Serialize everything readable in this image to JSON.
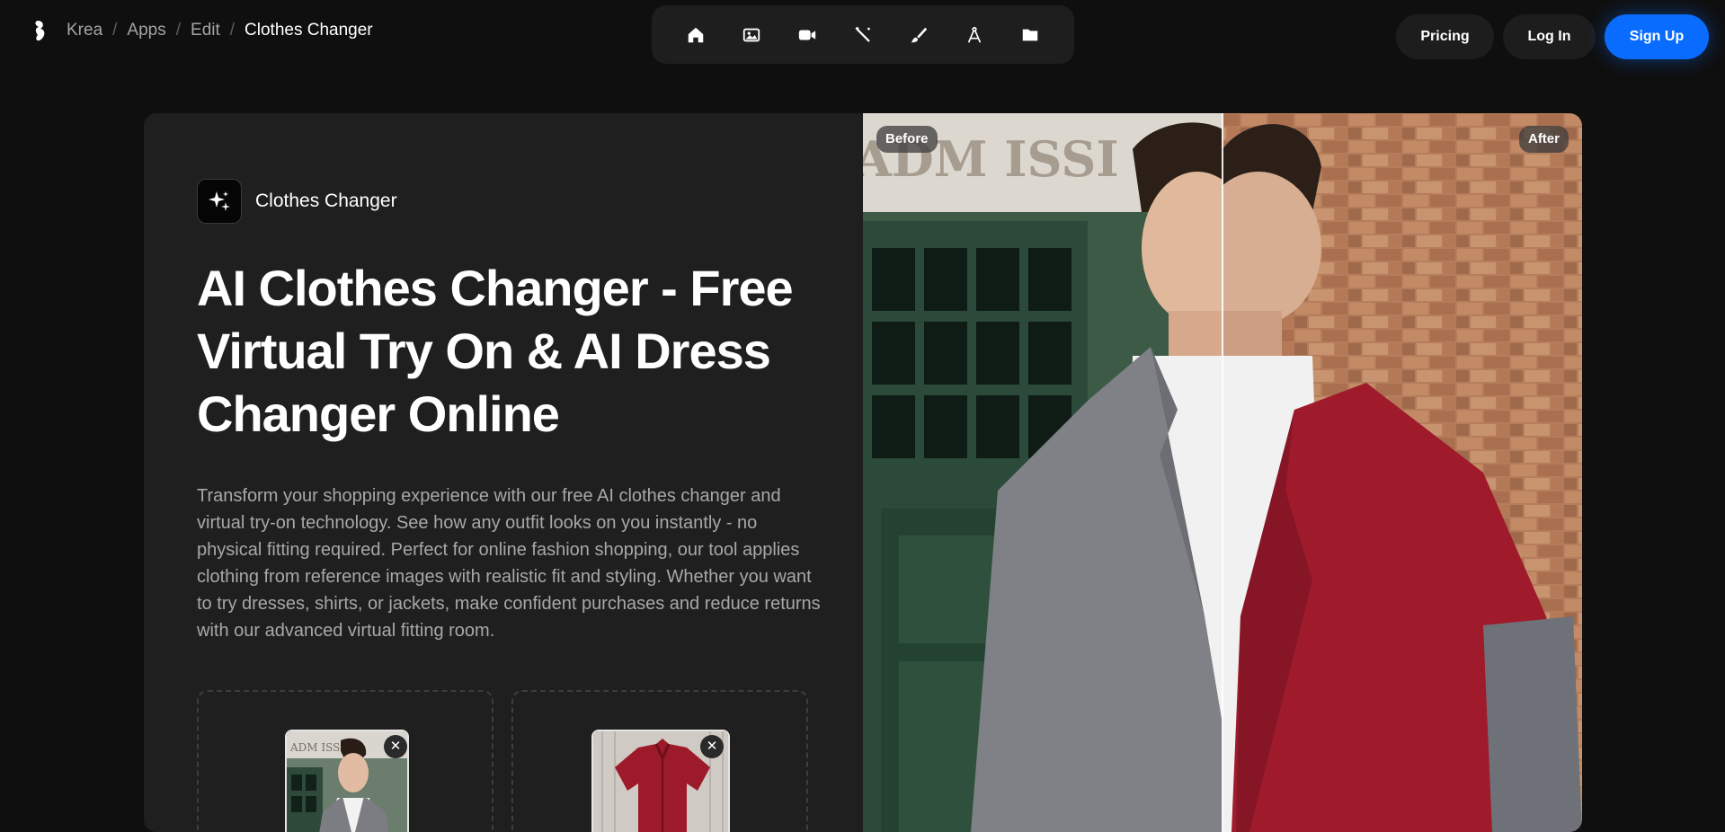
{
  "breadcrumb": [
    "Krea",
    "Apps",
    "Edit",
    "Clothes Changer"
  ],
  "toolbar": [
    "home-icon",
    "image-icon",
    "video-icon",
    "magic-wand-icon",
    "brush-icon",
    "compass-icon",
    "folder-icon"
  ],
  "auth": {
    "pricing": "Pricing",
    "login": "Log In",
    "signup": "Sign Up"
  },
  "app": {
    "name": "Clothes Changer",
    "icon": "sparkles-icon"
  },
  "headline": "AI Clothes Changer - Free Virtual Try On & AI Dress Changer Online",
  "description": "Transform your shopping experience with our free AI clothes changer and virtual try-on technology. See how any outfit looks on you instantly - no physical fitting required. Perfect for online fashion shopping, our tool applies clothing from reference images with realistic fit and styling. Whether you want to try dresses, shirts, or jackets, make confident purchases and reduce returns with our advanced virtual fitting room.",
  "compare": {
    "before_label": "Before",
    "after_label": "After",
    "split": 0.5,
    "sign_text": "ADM ISSI"
  },
  "uploads": [
    {
      "name": "person-photo",
      "remove": "✕"
    },
    {
      "name": "shirt-photo",
      "remove": "✕"
    }
  ],
  "colors": {
    "accent": "#0a6cff",
    "card": "#1f1f1f",
    "background": "#0f0f0f"
  }
}
